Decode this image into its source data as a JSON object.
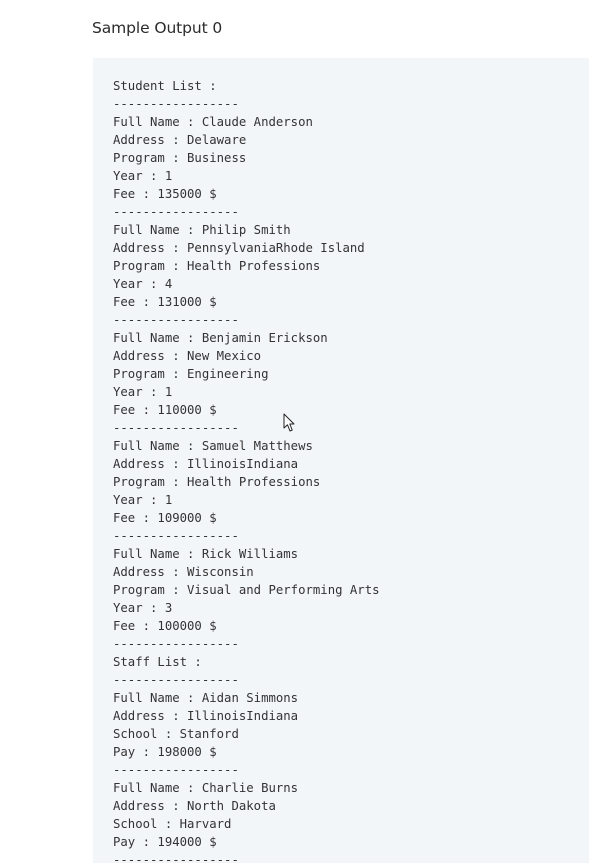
{
  "heading": "Sample Output 0",
  "output": {
    "lines": [
      "Student List :",
      "-----------------",
      "Full Name : Claude Anderson",
      "Address : Delaware",
      "Program : Business",
      "Year : 1",
      "Fee : 135000 $",
      "-----------------",
      "Full Name : Philip Smith",
      "Address : PennsylvaniaRhode Island",
      "Program : Health Professions",
      "Year : 4",
      "Fee : 131000 $",
      "-----------------",
      "Full Name : Benjamin Erickson",
      "Address : New Mexico",
      "Program : Engineering",
      "Year : 1",
      "Fee : 110000 $",
      "-----------------",
      "Full Name : Samuel Matthews",
      "Address : IllinoisIndiana",
      "Program : Health Professions",
      "Year : 1",
      "Fee : 109000 $",
      "-----------------",
      "Full Name : Rick Williams",
      "Address : Wisconsin",
      "Program : Visual and Performing Arts",
      "Year : 3",
      "Fee : 100000 $",
      "-----------------",
      "Staff List :",
      "-----------------",
      "Full Name : Aidan Simmons",
      "Address : IllinoisIndiana",
      "School : Stanford",
      "Pay : 198000 $",
      "-----------------",
      "Full Name : Charlie Burns",
      "Address : North Dakota",
      "School : Harvard",
      "Pay : 194000 $",
      "-----------------"
    ]
  },
  "icons": {
    "cursor": "mouse-pointer-icon"
  }
}
